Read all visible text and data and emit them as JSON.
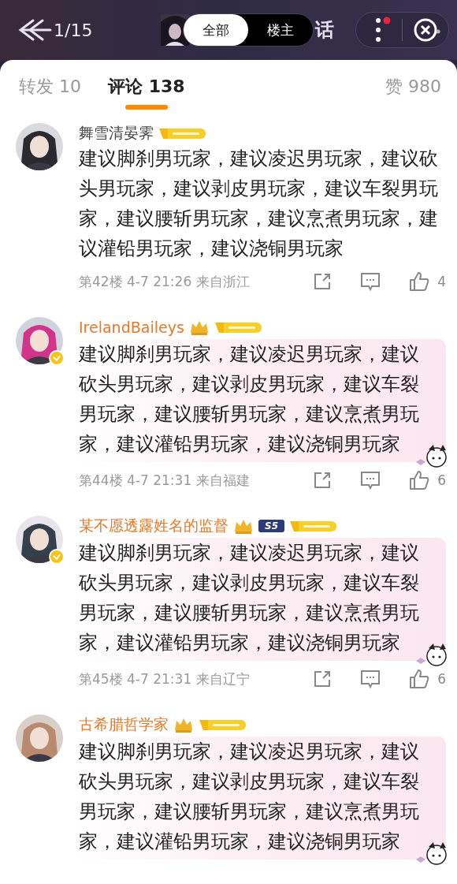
{
  "header": {
    "counter": "1/15",
    "filter": [
      {
        "label": "全部",
        "selected": true
      },
      {
        "label": "楼主",
        "selected": false
      }
    ],
    "title_fragment": "话"
  },
  "tabs": [
    {
      "label": "转发 10",
      "selected": false
    },
    {
      "label": "评论 138",
      "selected": true
    },
    {
      "label": "赞 980",
      "selected": false
    }
  ],
  "comments": [
    {
      "user": "舞雪清晏霁",
      "vip": false,
      "verified": false,
      "kind": "plain",
      "text": "建议脚刹男玩家，建议凌迟男玩家，建议砍头男玩家，建议剥皮男玩家，建议车裂男玩家，建议腰斩男玩家，建议烹煮男玩家，建议灌铅男玩家，建议浇铜男玩家",
      "floor": "第42楼",
      "time": "4-7 21:26",
      "location": "来自浙江",
      "likes": "4"
    },
    {
      "user": "IrelandBaileys",
      "vip": true,
      "verified": true,
      "kind": "bubble",
      "text": "建议脚刹男玩家，建议凌迟男玩家，建议砍头男玩家，建议剥皮男玩家，建议车裂男玩家，建议腰斩男玩家，建议烹煮男玩家，建议灌铅男玩家，建议浇铜男玩家",
      "floor": "第44楼",
      "time": "4-7 21:31",
      "location": "来自福建",
      "likes": "6"
    },
    {
      "user": "某不愿透露姓名的监督",
      "vip": true,
      "verified": true,
      "extra_badge": "S5",
      "kind": "bubble",
      "text": "建议脚刹男玩家，建议凌迟男玩家，建议砍头男玩家，建议剥皮男玩家，建议车裂男玩家，建议腰斩男玩家，建议烹煮男玩家，建议灌铅男玩家，建议浇铜男玩家",
      "floor": "第45楼",
      "time": "4-7 21:31",
      "location": "来自辽宁",
      "likes": "6"
    },
    {
      "user": "古希腊哲学家",
      "vip": true,
      "verified": false,
      "kind": "bubble",
      "text": "建议脚刹男玩家，建议凌迟男玩家，建议砍头男玩家，建议剥皮男玩家，建议车裂男玩家，建议腰斩男玩家，建议烹煮男玩家，建议灌铅男玩家，建议浇铜男玩家"
    }
  ]
}
